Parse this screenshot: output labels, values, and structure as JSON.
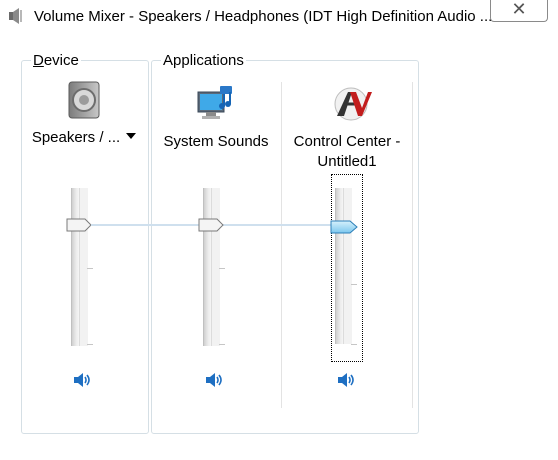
{
  "window": {
    "title": "Volume Mixer - Speakers / Headphones (IDT High Definition Audio ...",
    "close_glyph": "✕"
  },
  "device_group": {
    "label_accel": "D",
    "label_rest": "evice",
    "speakers_label": "Speakers / ...",
    "level_percent": 78
  },
  "applications_group": {
    "label": "Applications",
    "apps": [
      {
        "name": "System Sounds",
        "level_percent": 78,
        "icon": "system-sounds-icon"
      },
      {
        "name_line1": "Control Center -",
        "name_line2": "Untitled1",
        "level_percent": 78,
        "icon": "control-center-icon"
      }
    ]
  },
  "colors": {
    "accent_blue": "#1e6fc2",
    "thumb_active": "#8fd0f0",
    "group_border": "#d5dfe5"
  }
}
